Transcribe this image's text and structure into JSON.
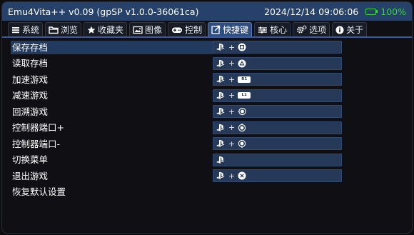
{
  "titlebar": {
    "title": "Emu4Vita++ v0.09 (gpSP v1.0.0-36061ca)",
    "clock": "2024/12/14 09:06:06",
    "battery": "100%",
    "battery_level": 1.0,
    "battery_color": "#3bd23b"
  },
  "tabs": [
    {
      "label": "系统",
      "icon": "menu-icon"
    },
    {
      "label": "浏览",
      "icon": "folder-icon"
    },
    {
      "label": "收藏夹",
      "icon": "star-icon"
    },
    {
      "label": "图像",
      "icon": "image-icon"
    },
    {
      "label": "控制",
      "icon": "gamepad-icon"
    },
    {
      "label": "快捷键",
      "icon": "shortcut-icon",
      "active": true
    },
    {
      "label": "核心",
      "icon": "sliders-icon"
    },
    {
      "label": "选项",
      "icon": "gears-icon"
    },
    {
      "label": "关于",
      "icon": "info-icon"
    }
  ],
  "hotkeys": [
    {
      "label": "保存存档",
      "button": "square",
      "selected": true
    },
    {
      "label": "读取存档",
      "button": "triangle"
    },
    {
      "label": "加速游戏",
      "button": "R1",
      "key_text": "R1"
    },
    {
      "label": "减速游戏",
      "button": "L1",
      "key_text": "L1"
    },
    {
      "label": "回溯游戏",
      "button": "right-analog"
    },
    {
      "label": "控制器端口+",
      "button": "right-analog-up"
    },
    {
      "label": "控制器端口-",
      "button": "right-analog-down"
    },
    {
      "label": "切换菜单",
      "button": "none"
    },
    {
      "label": "退出游戏",
      "button": "cross"
    },
    {
      "label": "恢复默认设置"
    }
  ],
  "plus": "+",
  "colors": {
    "titlebar": "#26416a",
    "tab_active": "#2e4d80",
    "binding": "#263958",
    "selected_row": "#233a5f"
  }
}
